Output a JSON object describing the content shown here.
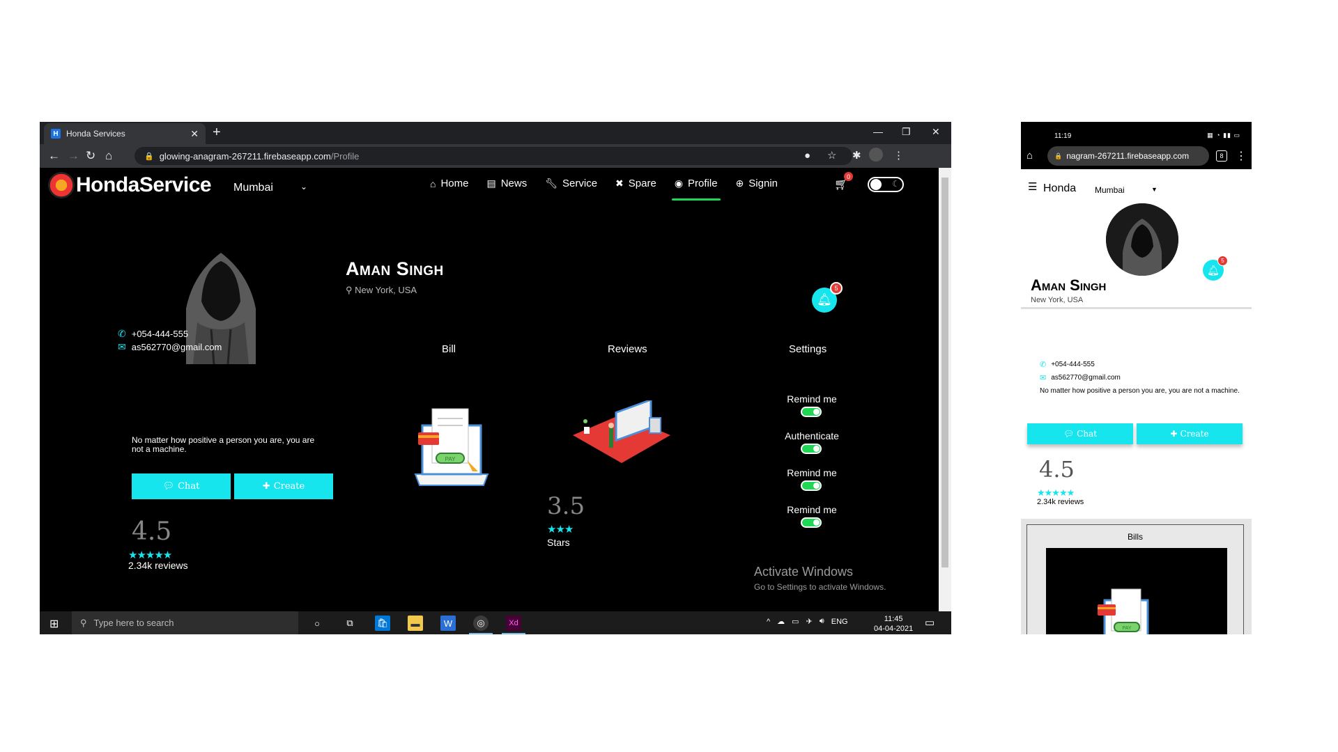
{
  "browser": {
    "tab_title": "Honda Services",
    "url_domain": "glowing-anagram-267211.firebaseapp.com",
    "url_path": "/Profile"
  },
  "site": {
    "brand": "HondaService",
    "city": "Mumbai",
    "nav": [
      {
        "label": "Home",
        "icon": "home-icon"
      },
      {
        "label": "News",
        "icon": "newspaper-icon"
      },
      {
        "label": "Service",
        "icon": "wrench-icon"
      },
      {
        "label": "Spare",
        "icon": "tools-icon"
      },
      {
        "label": "Profile",
        "icon": "user-circle-icon"
      },
      {
        "label": "Signin",
        "icon": "signin-icon"
      }
    ],
    "active_nav": "Profile",
    "cart_count": "0"
  },
  "profile": {
    "name": "Aman Singh",
    "location_city": "New York,",
    "location_country": "USA",
    "notification_count": "5",
    "phone": "+054-444-555",
    "email": "as562770@gmail.com",
    "quote": "No matter how positive a person you are, you are not a machine.",
    "chat_label": "Chat",
    "create_label": "Create",
    "rating": "4.5",
    "rating_stars": "★★★★★",
    "reviews_count": "2.34k",
    "reviews_word": "reviews"
  },
  "columns": {
    "bill": "Bill",
    "reviews": "Reviews",
    "settings": "Settings"
  },
  "bill_image": {
    "badge": "PAY"
  },
  "review_summary": {
    "value": "3.5",
    "stars": "★★★",
    "label": "Stars"
  },
  "settings": [
    {
      "label": "Remind me",
      "on": true
    },
    {
      "label": "Authenticate",
      "on": true
    },
    {
      "label": "Remind me",
      "on": true
    },
    {
      "label": "Remind me",
      "on": true
    }
  ],
  "watermark": {
    "line1": "Activate Windows",
    "line2": "Go to Settings to activate Windows."
  },
  "taskbar": {
    "search_placeholder": "Type here to search",
    "lang": "ENG",
    "time": "11:45",
    "date": "04-04-2021",
    "app_xd": "Xd"
  },
  "mobile": {
    "time": "11:19",
    "url": "nagram-267211.firebaseapp.com",
    "tabs_count": "8",
    "brand": "Honda",
    "city": "Mumbai",
    "name": "Aman Singh",
    "location_city": "New York,",
    "location_country": "USA",
    "notification_count": "5",
    "phone": "+054-444-555",
    "email": "as562770@gmail.com",
    "quote": "No matter how positive a person you are, you are not a machine.",
    "chat_label": "Chat",
    "create_label": "Create",
    "rating": "4.5",
    "rating_stars": "★★★★★",
    "reviews_count": "2.34k",
    "reviews_word": "reviews",
    "bills_title": "Bills"
  },
  "colors": {
    "accent_cyan": "#17e5ee",
    "active_green": "#1fd655",
    "badge_red": "#e53935"
  }
}
